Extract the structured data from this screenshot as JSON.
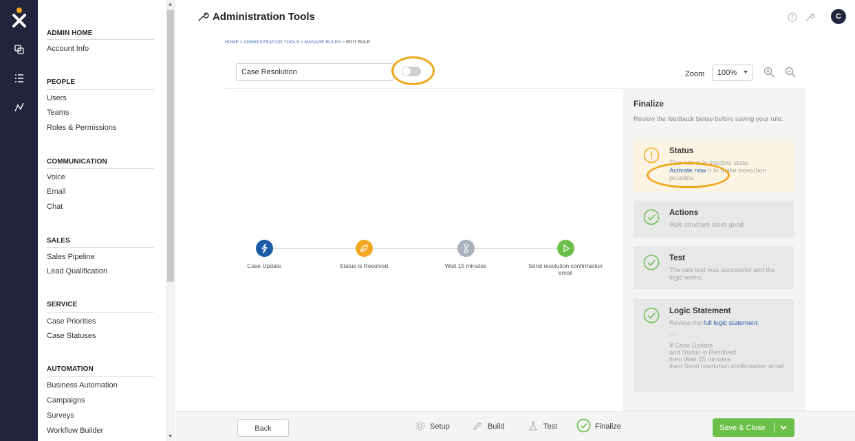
{
  "app": {
    "title": "Administration Tools",
    "avatar": "C"
  },
  "rail": {
    "icons": [
      "nextiva-logo-icon",
      "copy-icon",
      "list-icon",
      "analytics-icon"
    ]
  },
  "sidebar": {
    "sections": [
      {
        "heading": "ADMIN HOME",
        "items": [
          "Account Info"
        ]
      },
      {
        "heading": "PEOPLE",
        "items": [
          "Users",
          "Teams",
          "Roles & Permissions"
        ]
      },
      {
        "heading": "COMMUNICATION",
        "items": [
          "Voice",
          "Email",
          "Chat"
        ]
      },
      {
        "heading": "SALES",
        "items": [
          "Sales Pipeline",
          "Lead Qualification"
        ]
      },
      {
        "heading": "SERVICE",
        "items": [
          "Case Priorities",
          "Case Statuses"
        ]
      },
      {
        "heading": "AUTOMATION",
        "items": [
          "Business Automation",
          "Campaigns",
          "Surveys",
          "Workflow Builder"
        ]
      }
    ]
  },
  "breadcrumb": {
    "home": "HOME",
    "admin": "ADMINISTRATION TOOLS",
    "rules": "MANAGE RULES",
    "current": "EDIT RULE",
    "sep": " > "
  },
  "rule": {
    "name": "Case Resolution",
    "active": false
  },
  "zoom": {
    "label": "Zoom",
    "value": "100%"
  },
  "flow": {
    "nodes": [
      {
        "label": "Case Update",
        "color": "#1b5aa6",
        "icon": "lightning-icon"
      },
      {
        "label": "Status is Resolved",
        "color": "#f5a623",
        "icon": "leaf-icon"
      },
      {
        "label": "Wait 15 minutes",
        "color": "#a8b0bb",
        "icon": "hourglass-icon"
      },
      {
        "label": "Send resolution confirmation email",
        "color": "#6cc04a",
        "icon": "play-icon"
      }
    ]
  },
  "finalize": {
    "heading": "Finalize",
    "subtitle": "Review the feedback below before saving your rule:",
    "status": {
      "title": "Status",
      "text_before": "This rule is in inactive state.",
      "link": "Activate now",
      "text_after": " it to make execution possible."
    },
    "actions": {
      "title": "Actions",
      "text": "Rule structure looks good."
    },
    "test": {
      "title": "Test",
      "text": "The rule test was successful and the logic works."
    },
    "logic": {
      "title": "Logic Statement",
      "text_before": "Review the ",
      "link": "full logic statement",
      "text_after": ".",
      "divider": "---",
      "lines": [
        "If Case Update",
        "and Status is Resolved",
        "then Wait 15 minutes",
        "then Send resolution confirmation email"
      ]
    }
  },
  "footer": {
    "back": "Back",
    "steps": [
      "Setup",
      "Build",
      "Test",
      "Finalize"
    ],
    "save": "Save & Close"
  },
  "colors": {
    "highlight": "#f0a818",
    "primary_green": "#6cc04a",
    "link_blue": "#2f63b0",
    "rail_bg": "#22243d"
  }
}
